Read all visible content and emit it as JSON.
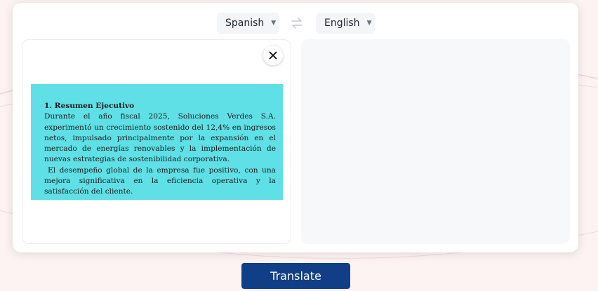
{
  "languages": {
    "source": "Spanish",
    "target": "English",
    "caret_icon": "caret-down-icon",
    "swap_icon": "swap-arrows-icon"
  },
  "source_panel": {
    "close_icon": "close-icon",
    "document": {
      "heading": "1. Resumen Ejecutivo",
      "paragraphs": [
        "Durante el año fiscal 2025, Soluciones Verdes S.A. experimentó un crecimiento sostenido del 12,4% en ingresos netos, impulsado principalmente por la expansión en el mercado de energías renovables y la implementación de nuevas estrategias de sostenibilidad corporativa.",
        "El desempeño global de la empresa fue positivo, con una mejora significativa en la eficiencia operativa y la satisfacción del cliente."
      ],
      "background_color": "#5ee0e6"
    }
  },
  "target_panel": {
    "translated_text": ""
  },
  "actions": {
    "translate_label": "Translate",
    "button_color": "#113f87"
  }
}
